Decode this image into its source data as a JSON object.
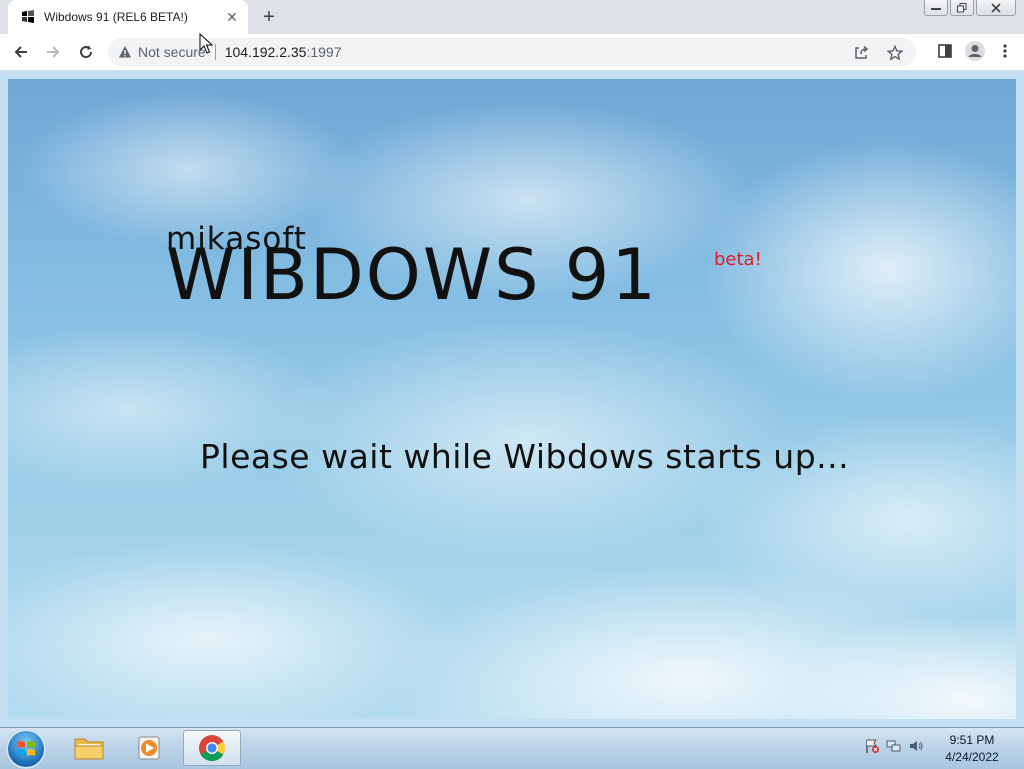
{
  "browser": {
    "tab_title": "Wibdows 91 (REL6 BETA!)",
    "new_tab_label": "+",
    "security_label": "Not secure",
    "url_host": "104.192.2.35",
    "url_port": ":1997"
  },
  "page": {
    "brand_small": "mikasoft",
    "brand_title": "WIBDOWS 91",
    "brand_badge": "beta!",
    "loading_message": "Please wait while Wibdows starts up..."
  },
  "taskbar": {
    "time": "9:51 PM",
    "date": "4/24/2022"
  },
  "colors": {
    "beta_badge": "#d8202a",
    "tab_bg": "#ffffff",
    "chrome_bg": "#dee1e6"
  }
}
